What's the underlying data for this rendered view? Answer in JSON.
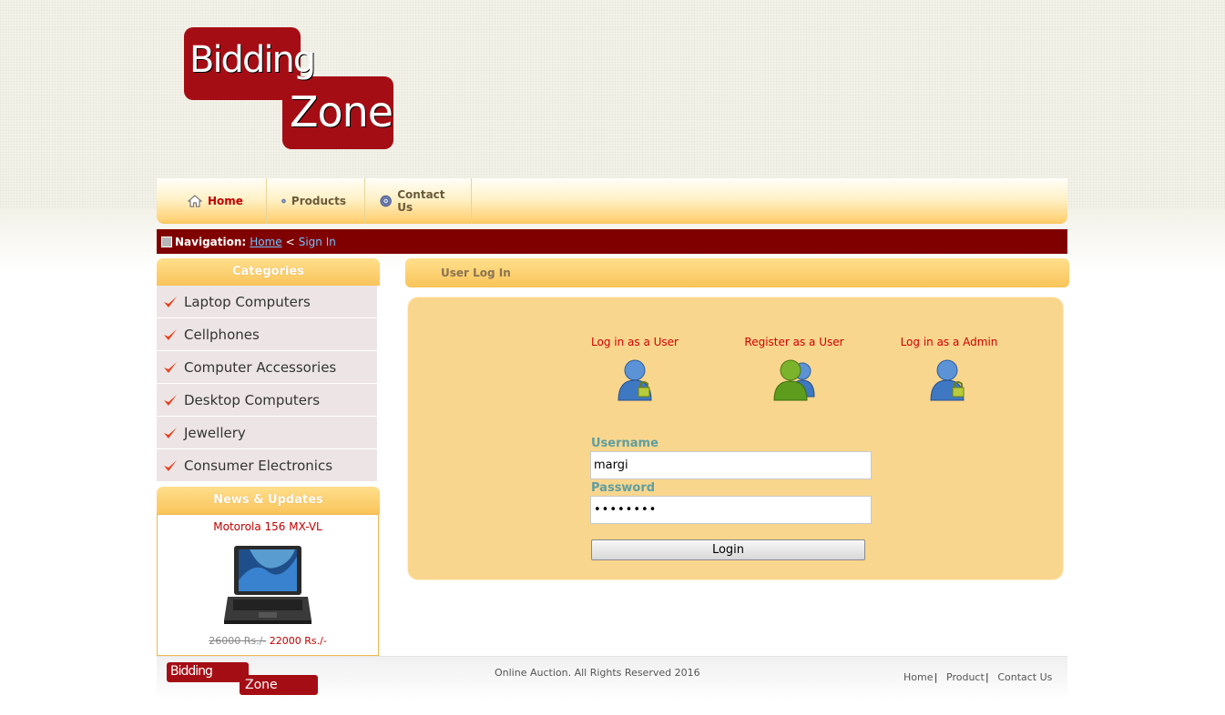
{
  "logo": {
    "line1": "Bidding",
    "line2": "Zone",
    "footer_line1": "Bidding",
    "footer_line2": "Zone"
  },
  "nav": {
    "items": [
      {
        "label": "Home",
        "icon": "home-icon"
      },
      {
        "label": "Products",
        "icon": "gear-icon"
      },
      {
        "label": "Contact Us",
        "icon": "gear-icon"
      }
    ]
  },
  "breadcrumb": {
    "label": "Navigation:",
    "home": "Home",
    "separator": "<",
    "current": "Sign In"
  },
  "sidebar": {
    "categories_title": "Categories",
    "categories": [
      "Laptop Computers",
      "Cellphones",
      "Computer Accessories",
      "Desktop Computers",
      "Jewellery",
      "Consumer Electronics"
    ],
    "news_title": "News & Updates",
    "news": {
      "product": "Motorola 156 MX-VL",
      "old_price": "26000 Rs./-",
      "new_price": "22000 Rs./-"
    }
  },
  "main": {
    "title": "User Log In",
    "options": [
      {
        "label": "Log in as a User",
        "icon": "user-lock-icon"
      },
      {
        "label": "Register as a User",
        "icon": "users-group-icon"
      },
      {
        "label": "Log in as a Admin",
        "icon": "admin-lock-icon"
      }
    ],
    "username_label": "Username",
    "username_value": "margi",
    "password_label": "Password",
    "password_value": "••••••••",
    "login_button": "Login"
  },
  "footer": {
    "copyright": "Online Auction. All Rights Reserved 2016",
    "links": [
      "Home",
      "Product",
      "Contact Us"
    ],
    "separator": "|"
  },
  "colors": {
    "brand_red": "#a50d15",
    "breadcrumb_bg": "#800000",
    "panel_bg": "#f9d68e",
    "accent_orange": "#f9c45a",
    "label_teal": "#5f9ea0"
  }
}
